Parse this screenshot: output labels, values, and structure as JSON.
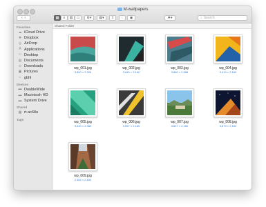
{
  "window": {
    "title": "M-wallpapers"
  },
  "toolbar": {
    "search_placeholder": "Search"
  },
  "pathbar": {
    "label": "Shared Folder"
  },
  "sidebar": {
    "favorites_label": "Favorites",
    "favorites": [
      {
        "label": "iCloud Drive",
        "icon": "cloud-icon"
      },
      {
        "label": "Dropbox",
        "icon": "dropbox-icon"
      },
      {
        "label": "AirDrop",
        "icon": "airdrop-icon"
      },
      {
        "label": "Applications",
        "icon": "applications-icon"
      },
      {
        "label": "Desktop",
        "icon": "desktop-icon"
      },
      {
        "label": "Documents",
        "icon": "documents-icon"
      },
      {
        "label": "Downloads",
        "icon": "downloads-icon"
      },
      {
        "label": "Pictures",
        "icon": "pictures-icon"
      },
      {
        "label": "gbhl",
        "icon": "home-icon"
      }
    ],
    "devices_label": "Devices",
    "devices": [
      {
        "label": "DoubleWide",
        "icon": "disk-icon"
      },
      {
        "label": "Macintosh HD",
        "icon": "disk-icon"
      },
      {
        "label": "System Drive",
        "icon": "disk-icon"
      }
    ],
    "shared_label": "Shared",
    "shared": [
      {
        "label": "rt-ac68u",
        "icon": "network-icon"
      }
    ],
    "tags_label": "Tags"
  },
  "files": [
    {
      "name": "wp_001.jpg",
      "size": "3,850 × 2,309"
    },
    {
      "name": "wp_002.jpg",
      "size": "3,840 × 2,160"
    },
    {
      "name": "wp_003.jpg",
      "size": "3,880 × 2,588"
    },
    {
      "name": "wp_004.jpg",
      "size": "3,419 × 2,160"
    },
    {
      "name": "wp_005.jpg",
      "size": "3,440 × 2,380"
    },
    {
      "name": "wp_006.jpg",
      "size": "3,597 × 2,160"
    },
    {
      "name": "wp_007.jpg",
      "size": "3,827 × 2,160"
    },
    {
      "name": "wp_008.jpg",
      "size": "3,879 × 2,160"
    },
    {
      "name": "wp_009.jpg",
      "size": "2,484 × 2,160"
    }
  ],
  "colors": {
    "accent": "#3b82d6",
    "folder": "#7cb5ec"
  }
}
